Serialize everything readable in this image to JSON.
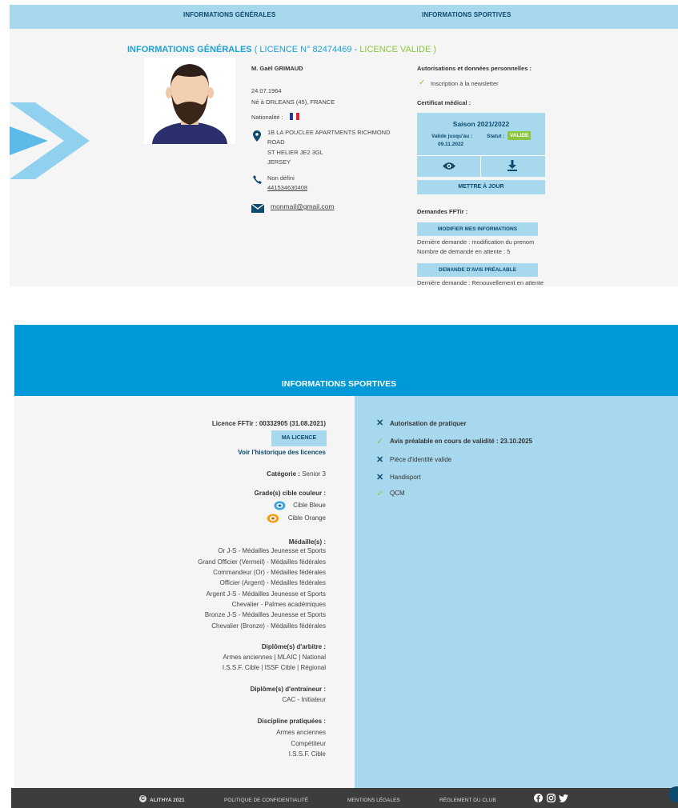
{
  "nav": {
    "tab_general": "INFORMATIONS GÉNÉRALES",
    "tab_sport": "INFORMATIONS SPORTIVES"
  },
  "general": {
    "title": "INFORMATIONS GÉNÉRALES",
    "licence_prefix": "( LICENCE N° 82474469 - ",
    "licence_status": "LICENCE VALIDE )",
    "name": "M. Gaël GRIMAUD",
    "birth_date": "24.07.1964",
    "birth_place": "Né à  ORLEANS (45), FRANCE",
    "nationality_label": "Nationalité :",
    "address_line1": "1B LA POUCLEE APARTMENTS RICHMOND",
    "address_line2": "ROAD",
    "address_line3": "ST HELIER JE2 3GL",
    "address_line4": "JERSEY",
    "phone_label": "Non défini",
    "phone_number": "441534630408",
    "email": "monmail@gmail.com"
  },
  "right_panel": {
    "auth_title": "Autorisations et données personnelles :",
    "newsletter": "Inscription à la newsletter",
    "cert_title": "Certificat médical :",
    "season": "Saison 2021/2022",
    "valid_until_label": "Valide jusqu'au :",
    "valid_until_date": "09.11.2022",
    "status_label": "Statut :",
    "status_value": "VALIDE",
    "update_button": "METTRE À JOUR",
    "requests_title": "Demandes FFTir :",
    "modify_button": "MODIFIER MES INFORMATIONS",
    "last_request": "Dernière demande : modification du prenom",
    "pending_count": "Nombre de demande en attente : 5",
    "prior_opinion_button": "DEMANDE D'AVIS PRÉALABLE",
    "last_request_2": "Dernière demande : Renouvellement en attente"
  },
  "sport": {
    "title": "INFORMATIONS SPORTIVES",
    "licence_label": "Licence FFTir :",
    "licence_value": "00332905 (31.08.2021)",
    "my_licence_button": "MA LICENCE",
    "history_link": "Voir l'historique des licences",
    "category_label": "Catégorie :",
    "category_value": "Senior 3",
    "grades_title": "Grade(s) cible couleur :",
    "grade1": "Cible Bleue",
    "grade2": "Cible Orange",
    "medals_title": "Médaille(s) :",
    "medals": [
      "Or J-S - Médailles Jeunesse et Sports",
      "Grand Officier (Vermeil) - Médailles fédérales",
      "Commandeur (Or) - Médailles fédérales",
      "Officier (Argent) - Médailles fédérales",
      "Argent J-S - Médailles Jeunesse et Sports",
      "Chevalier - Palmes académiques",
      "Bronze J-S - Médailles Jeunesse et Sports",
      "Chevalier (Bronze) - Médailles fédérales"
    ],
    "referee_title": "Diplôme(s) d'arbitre :",
    "referee": [
      "Armes anciennes | MLAIC | National",
      "I.S.S.F. Cible | ISSF Cible | Régional"
    ],
    "coach_title": "Diplôme(s) d'entraineur :",
    "coach": [
      "CAC - Initiateur"
    ],
    "disciplines_title": "Discipline pratiquées :",
    "disciplines": [
      "Armes anciennes",
      "Compétiteur",
      "I.S.S.F. Cible"
    ],
    "checks": [
      {
        "label": "Autorisation de pratiquer",
        "state": "cross",
        "bold": true
      },
      {
        "label": "Avis préalable en cours de validité : 23.10.2025",
        "state": "check",
        "bold": true
      },
      {
        "label": "Pièce d'identité valide",
        "state": "cross",
        "bold": false
      },
      {
        "label": "Handisport",
        "state": "cross",
        "bold": false
      },
      {
        "label": "QCM",
        "state": "check",
        "bold": false
      }
    ]
  },
  "footer": {
    "copyright": "ALITHYA 2021",
    "privacy": "POLITIQUE DE CONFIDENTIALITÉ",
    "legal": "MENTIONS LÉGALES",
    "rules": "RÈGLEMENT DU CLUB"
  },
  "colors": {
    "accent_blue": "#1da1d6",
    "light_blue": "#a8d8ee",
    "band_blue": "#0099d8",
    "valid_green": "#8cc63f",
    "dark_navy": "#0d4a6e"
  },
  "icons": [
    "location-pin-icon",
    "phone-icon",
    "mail-icon",
    "eye-icon",
    "download-icon",
    "check-icon",
    "cross-icon",
    "facebook-icon",
    "instagram-icon",
    "twitter-icon",
    "flag-france-icon",
    "target-icon"
  ]
}
